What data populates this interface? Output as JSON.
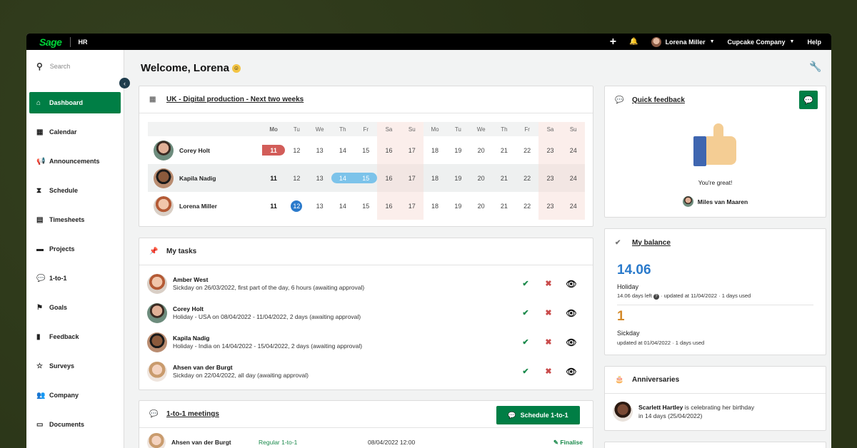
{
  "topbar": {
    "logo": "Sage",
    "module": "HR",
    "add_icon": "+",
    "bell_icon": "🔔",
    "user_name": "Lorena Miller",
    "company": "Cupcake Company",
    "help": "Help"
  },
  "sidebar": {
    "search_placeholder": "Search",
    "collapse_icon": "‹",
    "items": [
      {
        "label": "Dashboard",
        "icon": "⌂"
      },
      {
        "label": "Calendar",
        "icon": "▦"
      },
      {
        "label": "Announcements",
        "icon": "📢"
      },
      {
        "label": "Schedule",
        "icon": "⧗"
      },
      {
        "label": "Timesheets",
        "icon": "▤"
      },
      {
        "label": "Projects",
        "icon": "▬"
      },
      {
        "label": "1-to-1",
        "icon": "💬"
      },
      {
        "label": "Goals",
        "icon": "⚑"
      },
      {
        "label": "Feedback",
        "icon": "▮"
      },
      {
        "label": "Surveys",
        "icon": "☆"
      },
      {
        "label": "Company",
        "icon": "👥"
      },
      {
        "label": "Documents",
        "icon": "▭"
      }
    ]
  },
  "main": {
    "welcome": "Welcome, Lorena",
    "smiley": "☺",
    "wrench_icon": "🔧"
  },
  "calendar": {
    "title": "UK - Digital production - Next two weeks",
    "icon": "▦",
    "days": [
      "Mo",
      "Tu",
      "We",
      "Th",
      "Fr",
      "Sa",
      "Su",
      "Mo",
      "Tu",
      "We",
      "Th",
      "Fr",
      "Sa",
      "Su"
    ],
    "people": [
      {
        "name": "Corey Holt",
        "dates": [
          "11",
          "12",
          "13",
          "14",
          "15",
          "16",
          "17",
          "18",
          "19",
          "20",
          "21",
          "22",
          "23",
          "24"
        ]
      },
      {
        "name": "Kapila Nadig",
        "dates": [
          "11",
          "12",
          "13",
          "14",
          "15",
          "16",
          "17",
          "18",
          "19",
          "20",
          "21",
          "22",
          "23",
          "24"
        ]
      },
      {
        "name": "Lorena Miller",
        "dates": [
          "11",
          "12",
          "13",
          "14",
          "15",
          "16",
          "17",
          "18",
          "19",
          "20",
          "21",
          "22",
          "23",
          "24"
        ]
      }
    ]
  },
  "tasks": {
    "title": "My tasks",
    "icon": "📌",
    "items": [
      {
        "name": "Amber West",
        "desc": "Sickday on 26/03/2022, first part of the day, 6 hours (awaiting approval)"
      },
      {
        "name": "Corey Holt",
        "desc": "Holiday - USA on 08/04/2022 - 11/04/2022, 2 days (awaiting approval)"
      },
      {
        "name": "Kapila Nadig",
        "desc": "Holiday - India on 14/04/2022 - 15/04/2022, 2 days (awaiting approval)"
      },
      {
        "name": "Ahsen van der Burgt",
        "desc": "Sickday on 22/04/2022, all day (awaiting approval)"
      }
    ],
    "approve_icon": "✔",
    "reject_icon": "✖",
    "view_icon": "👁"
  },
  "meetings": {
    "title": "1-to-1 meetings",
    "icon": "💬",
    "button": "Schedule 1-to-1",
    "rows": [
      {
        "name": "Ahsen van der Burgt",
        "type": "Regular 1-to-1",
        "date": "08/04/2022 12:00",
        "action": "Finalise"
      }
    ]
  },
  "feedback": {
    "title": "Quick feedback",
    "icon": "💬",
    "message": "You're great!",
    "from": "Miles van Maaren"
  },
  "balance": {
    "title": "My balance",
    "icon": "✔",
    "holiday_value": "14.06",
    "holiday_label": "Holiday",
    "holiday_sub": "14.06 days left",
    "holiday_sub2": "· updated at 11/04/2022 · 1 days used",
    "sick_value": "1",
    "sick_label": "Sickday",
    "sick_sub": "updated at 01/04/2022 · 1 days used",
    "holiday_color": "#2a7acb",
    "sick_color": "#d48a2a"
  },
  "anniversaries": {
    "title": "Anniversaries",
    "icon": "🎂",
    "name": "Scarlett Hartley",
    "text": "is celebrating her birthday",
    "when": "in 14 days (25/04/2022)"
  }
}
